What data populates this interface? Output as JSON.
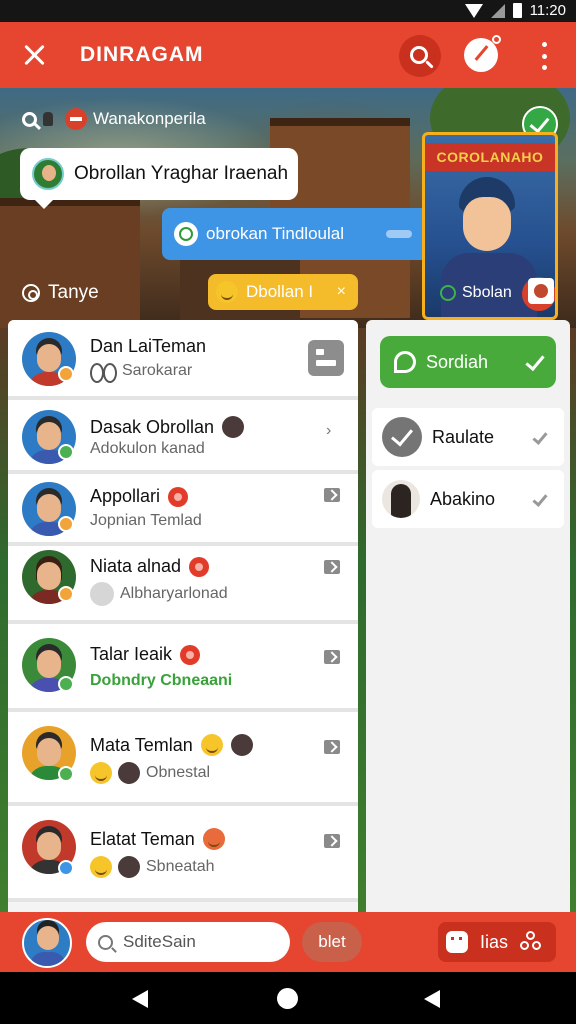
{
  "status_bar": {
    "time": "11:20"
  },
  "app_bar": {
    "title": "DINRAGAM"
  },
  "banner": {
    "search_label": "Wanakonperila",
    "white_bubble": "Obrollan Yraghar Iraenah",
    "blue_bubble": "obrokan Tindloulal",
    "type_label": "Tanye",
    "emoji_chip": "Dbollan I",
    "emoji_chip_close": "×",
    "card_title": "COROLANAHO",
    "card_plus": "+",
    "card_label": "Sbolan"
  },
  "chats": [
    {
      "name": "Dan LaiTeman",
      "sub": "Sarokarar"
    },
    {
      "name": "Dasak Obrollan",
      "sub": "Adokulon kanad"
    },
    {
      "name": "Appollari",
      "sub": "Jopnian Temlad"
    },
    {
      "name": "Niata alnad",
      "sub": "Albharyarlonad"
    },
    {
      "name": "Talar Ieaik",
      "sub": "Dobndry Cbneaani"
    },
    {
      "name": "Mata Temlan",
      "sub": "Obnestal"
    },
    {
      "name": "Elatat Teman",
      "sub": "Sbneatah"
    }
  ],
  "right_panel": {
    "primary_label": "Sordiah",
    "items": [
      {
        "label": "Raulate"
      },
      {
        "label": "Abakino"
      }
    ]
  },
  "bottom_bar": {
    "search_placeholder": "SditeSain",
    "chip_label": "blet",
    "action_label": "Iias"
  },
  "colors": {
    "primary": "#e6452f",
    "accent_green": "#49aa3c",
    "blue": "#3e95e6",
    "yellow": "#f4bb2a"
  }
}
